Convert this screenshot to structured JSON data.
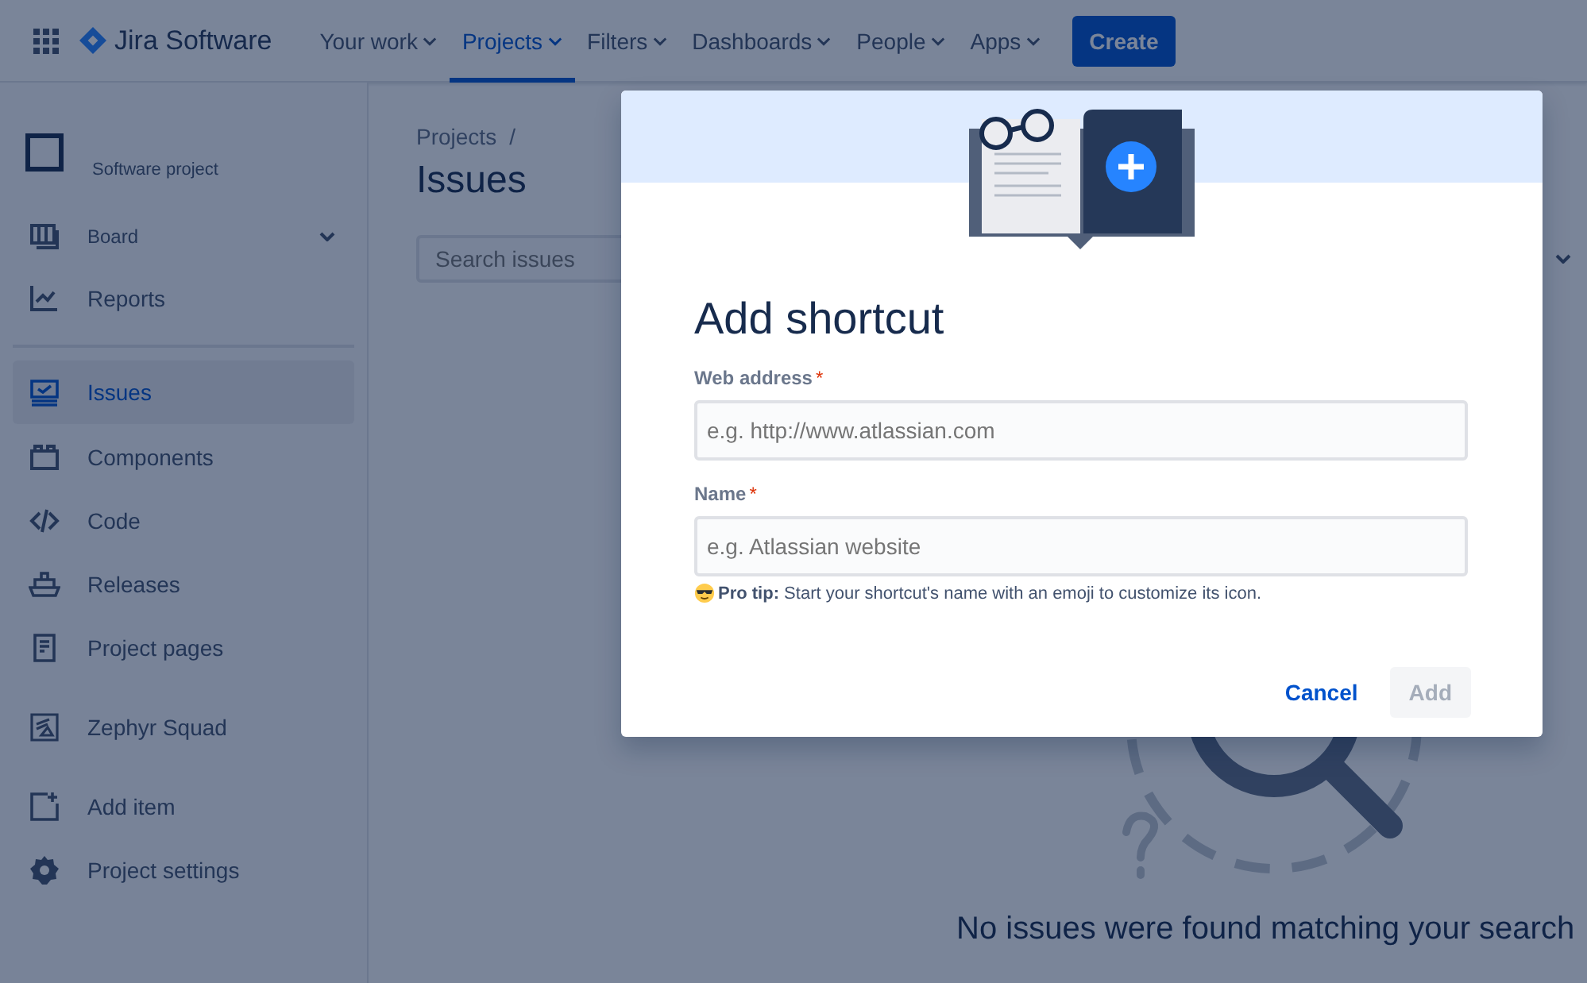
{
  "top_nav": {
    "product": "Jira Software",
    "items": [
      {
        "label": "Your work",
        "selected": false
      },
      {
        "label": "Projects",
        "selected": true
      },
      {
        "label": "Filters",
        "selected": false
      },
      {
        "label": "Dashboards",
        "selected": false
      },
      {
        "label": "People",
        "selected": false
      },
      {
        "label": "Apps",
        "selected": false
      }
    ],
    "create_button": "Create"
  },
  "sidebar": {
    "project_type": "Software project",
    "sections": [
      [
        {
          "label": "Board",
          "kind": "group",
          "selected": false
        },
        {
          "label": "Reports",
          "kind": "link",
          "selected": false
        }
      ],
      [
        {
          "label": "Issues",
          "kind": "link",
          "selected": true
        },
        {
          "label": "Components",
          "kind": "link",
          "selected": false
        },
        {
          "label": "Code",
          "kind": "link",
          "selected": false
        },
        {
          "label": "Releases",
          "kind": "link",
          "selected": false
        },
        {
          "label": "Project pages",
          "kind": "link",
          "selected": false
        }
      ],
      [
        {
          "label": "Zephyr Squad",
          "kind": "link",
          "selected": false
        }
      ],
      [
        {
          "label": "Add item",
          "kind": "link",
          "selected": false
        },
        {
          "label": "Project settings",
          "kind": "link",
          "selected": false
        }
      ]
    ]
  },
  "main": {
    "breadcrumb": [
      "Projects"
    ],
    "breadcrumb_separator": "/",
    "title": "Issues",
    "search": {
      "placeholder": "Search issues"
    },
    "empty_message": "No issues were found matching your search"
  },
  "dialog": {
    "title": "Add shortcut",
    "fields": [
      {
        "label": "Web address",
        "required_mark": "*",
        "placeholder": "e.g. http://www.atlassian.com"
      },
      {
        "label": "Name",
        "required_mark": "*",
        "placeholder": "e.g. Atlassian website"
      }
    ],
    "tip": "**Pro tip:** Start your shortcut's name with an emoji to customize its icon.",
    "buttons": [
      {
        "label": "Cancel",
        "kind": "subtle",
        "disabled": false
      },
      {
        "label": "Add",
        "kind": "primary",
        "disabled": true
      }
    ]
  }
}
